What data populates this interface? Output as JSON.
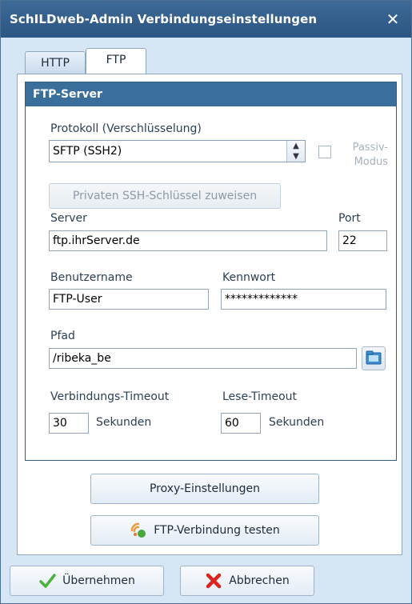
{
  "window": {
    "title": "SchILDweb-Admin Verbindungseinstellungen",
    "close_glyph": "✕"
  },
  "tabs": [
    {
      "label": "HTTP",
      "active": false
    },
    {
      "label": "FTP",
      "active": true
    }
  ],
  "group": {
    "title": "FTP-Server",
    "protocol_label": "Protokoll (Verschlüsselung)",
    "protocol_value": "SFTP (SSH2)",
    "passive_label_line1": "Passiv-",
    "passive_label_line2": "Modus",
    "passive_checked": false,
    "ssh_key_button": "Privaten SSH-Schlüssel zuweisen",
    "server_label": "Server",
    "server_value": "ftp.ihrServer.de",
    "port_label": "Port",
    "port_value": "22",
    "user_label": "Benutzername",
    "user_value": "FTP-User",
    "password_label": "Kennwort",
    "password_value": "*************",
    "path_label": "Pfad",
    "path_value": "/ribeka_be",
    "conn_timeout_label": "Verbindungs-Timeout",
    "conn_timeout_value": "30",
    "conn_timeout_unit": "Sekunden",
    "read_timeout_label": "Lese-Timeout",
    "read_timeout_value": "60",
    "read_timeout_unit": "Sekunden"
  },
  "buttons": {
    "proxy": "Proxy-Einstellungen",
    "test": "FTP-Verbindung testen",
    "apply": "Übernehmen",
    "cancel": "Abbrechen"
  },
  "icons": {
    "test": "connection-test-icon",
    "apply": "checkmark-icon",
    "cancel": "red-x-icon",
    "folder": "folder-browse-icon"
  },
  "colors": {
    "titlebar": "#2f5b88",
    "group_header": "#3a6f9b",
    "background": "#d7e6f5"
  }
}
